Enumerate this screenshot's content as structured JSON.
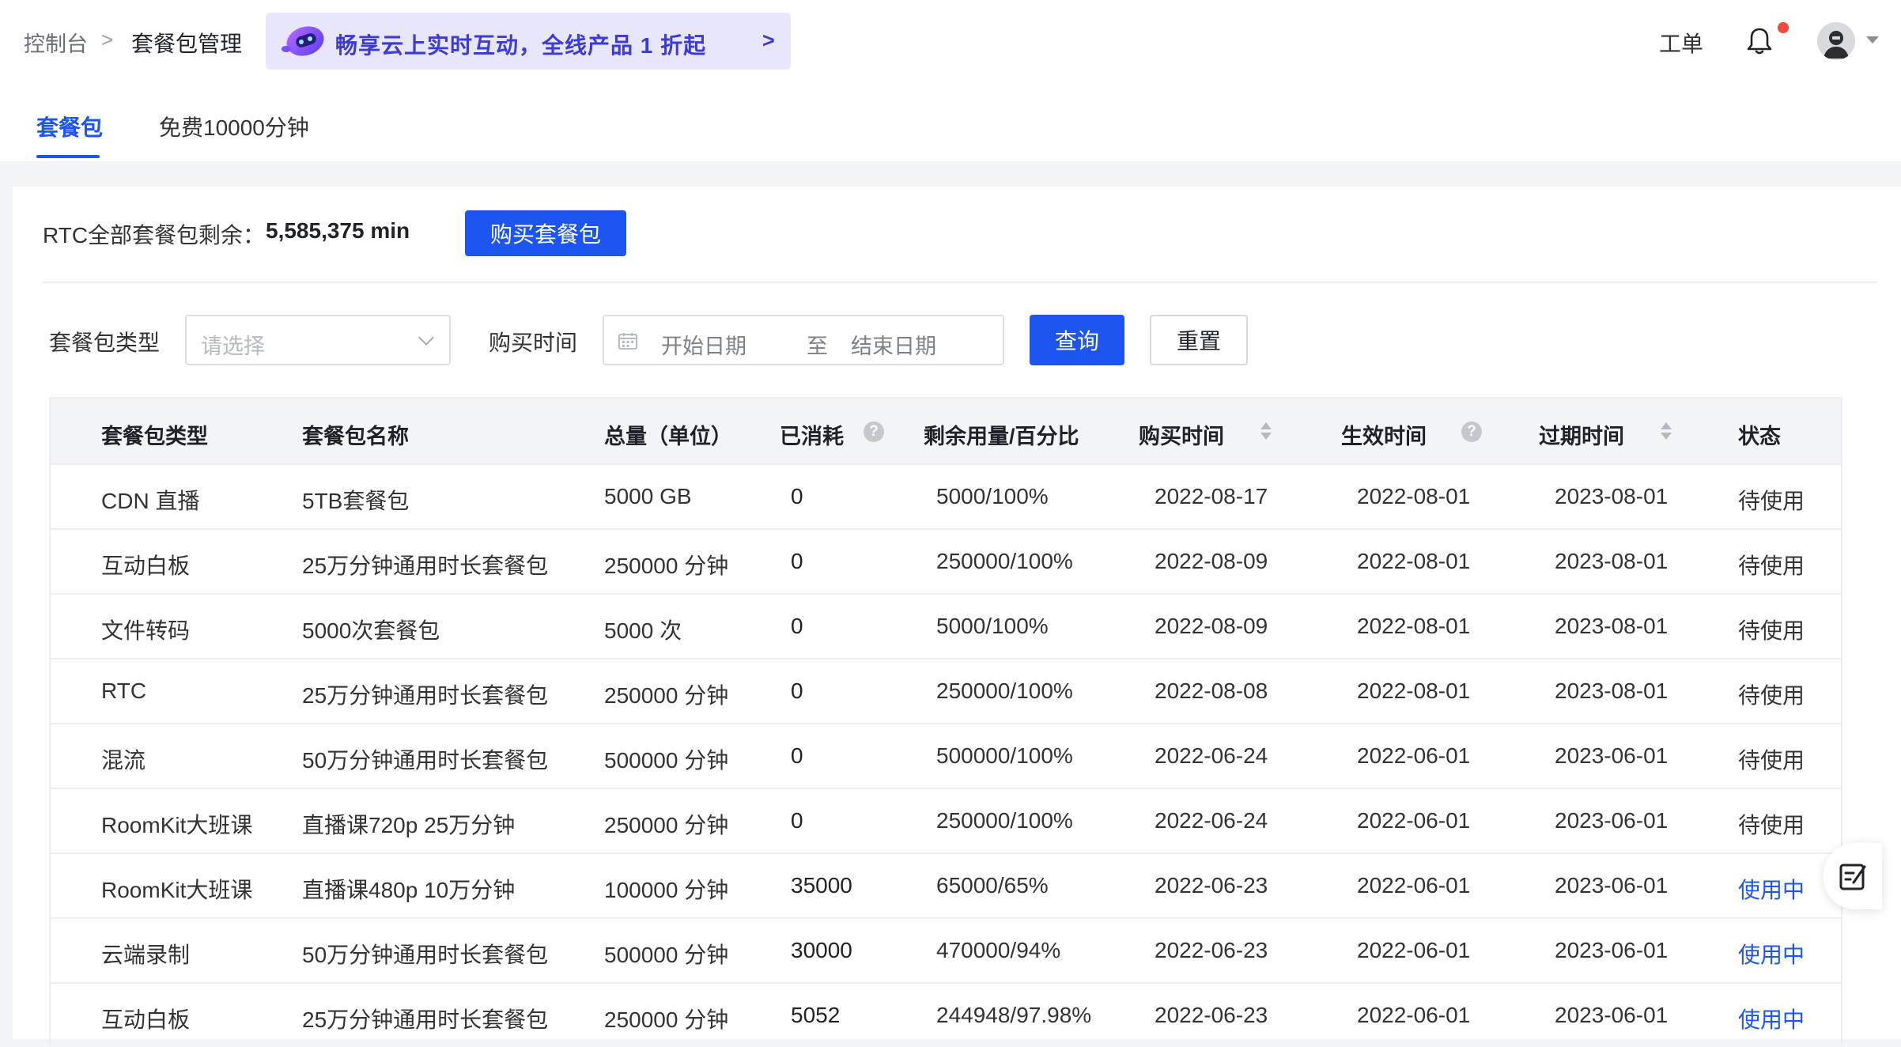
{
  "breadcrumb": {
    "root": "控制台",
    "separator": ">",
    "current": "套餐包管理"
  },
  "promo": {
    "text": "畅享云上实时互动，全线产品 1 折起",
    "arrow": ">"
  },
  "header": {
    "ticket": "工单"
  },
  "tabs": [
    {
      "label": "套餐包",
      "active": true
    },
    {
      "label": "免费10000分钟",
      "active": false
    }
  ],
  "summary": {
    "label": "RTC全部套餐包剩余：",
    "value": "5,585,375 min",
    "buy_label": "购买套餐包"
  },
  "filters": {
    "type_label": "套餐包类型",
    "type_placeholder": "请选择",
    "time_label": "购买时间",
    "start_placeholder": "开始日期",
    "to": "至",
    "end_placeholder": "结束日期",
    "query_label": "查询",
    "reset_label": "重置"
  },
  "table": {
    "columns": [
      "套餐包类型",
      "套餐包名称",
      "总量（单位）",
      "已消耗",
      "剩余用量/百分比",
      "购买时间",
      "生效时间",
      "过期时间",
      "状态"
    ],
    "rows": [
      [
        "CDN 直播",
        "5TB套餐包",
        "5000 GB",
        "0",
        "5000/100%",
        "2022-08-17",
        "2022-08-01",
        "2023-08-01",
        "待使用"
      ],
      [
        "互动白板",
        "25万分钟通用时长套餐包",
        "250000 分钟",
        "0",
        "250000/100%",
        "2022-08-09",
        "2022-08-01",
        "2023-08-01",
        "待使用"
      ],
      [
        "文件转码",
        "5000次套餐包",
        "5000 次",
        "0",
        "5000/100%",
        "2022-08-09",
        "2022-08-01",
        "2023-08-01",
        "待使用"
      ],
      [
        "RTC",
        "25万分钟通用时长套餐包",
        "250000 分钟",
        "0",
        "250000/100%",
        "2022-08-08",
        "2022-08-01",
        "2023-08-01",
        "待使用"
      ],
      [
        "混流",
        "50万分钟通用时长套餐包",
        "500000 分钟",
        "0",
        "500000/100%",
        "2022-06-24",
        "2022-06-01",
        "2023-06-01",
        "待使用"
      ],
      [
        "RoomKit大班课",
        "直播课720p 25万分钟",
        "250000 分钟",
        "0",
        "250000/100%",
        "2022-06-24",
        "2022-06-01",
        "2023-06-01",
        "待使用"
      ],
      [
        "RoomKit大班课",
        "直播课480p 10万分钟",
        "100000 分钟",
        "35000",
        "65000/65%",
        "2022-06-23",
        "2022-06-01",
        "2023-06-01",
        "使用中"
      ],
      [
        "云端录制",
        "50万分钟通用时长套餐包",
        "500000 分钟",
        "30000",
        "470000/94%",
        "2022-06-23",
        "2022-06-01",
        "2023-06-01",
        "使用中"
      ],
      [
        "互动白板",
        "25万分钟通用时长套餐包",
        "250000 分钟",
        "5052",
        "244948/97.98%",
        "2022-06-23",
        "2022-06-01",
        "2023-06-01",
        "使用中"
      ]
    ]
  },
  "colors": {
    "primary": "#1d55f0",
    "promo_bg": "#e7e6fd",
    "promo_text": "#3d3bd6",
    "notify_dot": "#f5483b"
  },
  "icons": [
    "chevron-right-icon",
    "promo-robot-icon",
    "bell-icon",
    "avatar-icon",
    "chevron-down-icon",
    "calendar-icon",
    "help-icon",
    "sort-icon",
    "edit-note-icon"
  ]
}
